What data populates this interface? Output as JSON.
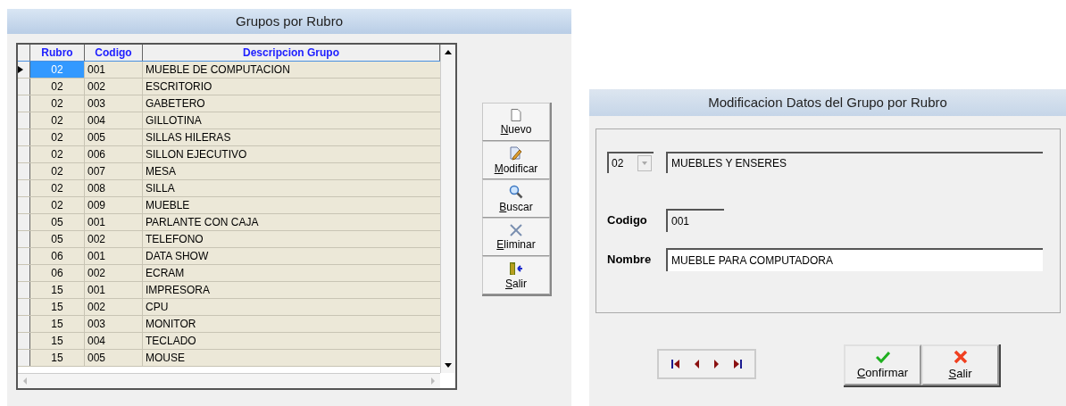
{
  "grupos_window": {
    "title": "Grupos por Rubro",
    "table": {
      "columns": [
        "Rubro",
        "Codigo",
        "Descripcion Grupo"
      ],
      "rows": [
        {
          "rubro": "02",
          "codigo": "001",
          "descripcion": "MUEBLE DE COMPUTACION",
          "selected": true
        },
        {
          "rubro": "02",
          "codigo": "002",
          "descripcion": "ESCRITORIO",
          "selected": false
        },
        {
          "rubro": "02",
          "codigo": "003",
          "descripcion": "GABETERO",
          "selected": false
        },
        {
          "rubro": "02",
          "codigo": "004",
          "descripcion": "GILLOTINA",
          "selected": false
        },
        {
          "rubro": "02",
          "codigo": "005",
          "descripcion": "SILLAS HILERAS",
          "selected": false
        },
        {
          "rubro": "02",
          "codigo": "006",
          "descripcion": "SILLON EJECUTIVO",
          "selected": false
        },
        {
          "rubro": "02",
          "codigo": "007",
          "descripcion": "MESA",
          "selected": false
        },
        {
          "rubro": "02",
          "codigo": "008",
          "descripcion": "SILLA",
          "selected": false
        },
        {
          "rubro": "02",
          "codigo": "009",
          "descripcion": "MUEBLE",
          "selected": false
        },
        {
          "rubro": "05",
          "codigo": "001",
          "descripcion": "PARLANTE CON CAJA",
          "selected": false
        },
        {
          "rubro": "05",
          "codigo": "002",
          "descripcion": "TELEFONO",
          "selected": false
        },
        {
          "rubro": "06",
          "codigo": "001",
          "descripcion": "DATA SHOW",
          "selected": false
        },
        {
          "rubro": "06",
          "codigo": "002",
          "descripcion": "ECRAM",
          "selected": false
        },
        {
          "rubro": "15",
          "codigo": "001",
          "descripcion": "IMPRESORA",
          "selected": false
        },
        {
          "rubro": "15",
          "codigo": "002",
          "descripcion": "CPU",
          "selected": false
        },
        {
          "rubro": "15",
          "codigo": "003",
          "descripcion": "MONITOR",
          "selected": false
        },
        {
          "rubro": "15",
          "codigo": "004",
          "descripcion": "TECLADO",
          "selected": false
        },
        {
          "rubro": "15",
          "codigo": "005",
          "descripcion": "MOUSE",
          "selected": false
        }
      ]
    },
    "buttons": [
      {
        "kind": "new",
        "label": "Nuevo",
        "underline_first": true
      },
      {
        "kind": "edit",
        "label": "Modificar",
        "underline_first": true
      },
      {
        "kind": "search",
        "label": "Buscar",
        "underline_first": true
      },
      {
        "kind": "delete",
        "label": "Eliminar",
        "underline_first": true
      },
      {
        "kind": "exit",
        "label": "Salir",
        "underline_first": true
      }
    ]
  },
  "modificacion_window": {
    "title": "Modificacion Datos del Grupo por Rubro",
    "rubro_combo": {
      "value": "02",
      "disabled": true
    },
    "rubro_description": {
      "value": "MUEBLES Y ENSERES"
    },
    "codigo": {
      "label": "Codigo",
      "value": "001"
    },
    "nombre": {
      "label": "Nombre",
      "value": "MUEBLE PARA COMPUTADORA"
    },
    "buttons": [
      {
        "kind": "confirm",
        "label": "Confirmar",
        "underline_first": true
      },
      {
        "kind": "exit",
        "label": "Salir",
        "underline_first": true
      }
    ]
  }
}
